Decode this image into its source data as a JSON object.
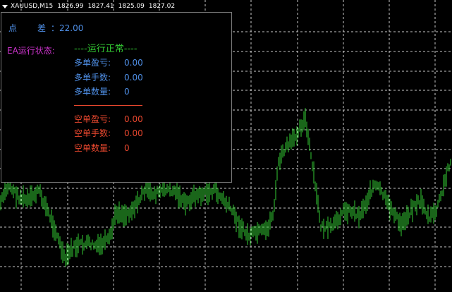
{
  "header": {
    "symbol": "XAUUSD,M15",
    "open": "1826.99",
    "high": "1827.41",
    "low": "1825.09",
    "close": "1827.02"
  },
  "panel": {
    "spread_label_1": "点",
    "spread_label_2": "差",
    "spread_value": "：22.00",
    "ea_status_label": "EA运行状态:",
    "ea_status_value": "----运行正常----",
    "long": [
      {
        "label": "多单盈亏:",
        "value": "0.00"
      },
      {
        "label": "多单手数:",
        "value": "0.00"
      },
      {
        "label": "多单数量:",
        "value": "0"
      }
    ],
    "short": [
      {
        "label": "空单盈亏:",
        "value": "0.00"
      },
      {
        "label": "空单手数:",
        "value": "0.00"
      },
      {
        "label": "空单数量:",
        "value": "0"
      }
    ]
  },
  "colors": {
    "background": "#000000",
    "candle": "#33cc33",
    "grid": "#c8c8c8",
    "long_text": "#4f8fe6",
    "short_text": "#e8472e",
    "status_label": "#cc33cc",
    "status_value": "#33cc33"
  }
}
